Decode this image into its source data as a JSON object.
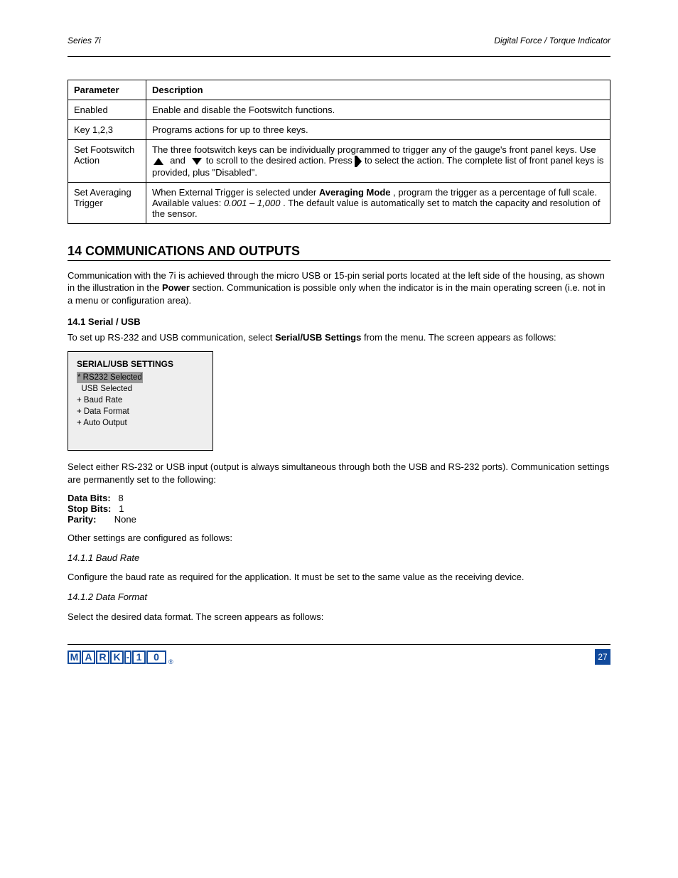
{
  "header": {
    "left": "Series 7i",
    "right": "Digital Force / Torque Indicator"
  },
  "table": {
    "headers": [
      "Parameter",
      "Description"
    ],
    "rows": [
      {
        "param": "Enabled",
        "desc": "Enable and disable the Footswitch functions."
      },
      {
        "param": "Key 1,2,3",
        "desc": "Programs actions for up to three keys."
      },
      {
        "param": "Set Footswitch Action",
        "desc_before": "The three footswitch keys can be individually programmed to trigger any of the gauge's front panel keys. Use ",
        "desc_mid": " to scroll to the desired action. Press ",
        "desc_after": " to select the action. The complete list of front panel keys is provided, plus \"Disabled\"."
      },
      {
        "param": "Set Averaging Trigger",
        "desc_before": "When External Trigger is selected under ",
        "desc_bold": "Averaging Mode",
        "desc_mid2": ", program the trigger as a percentage of full scale. Available values: ",
        "desc_italic": "0.001 – 1,000",
        "desc_after2": ". The default value is automatically set to match the capacity and resolution of the sensor."
      }
    ]
  },
  "section": {
    "number": "14",
    "title": "COMMUNICATIONS AND OUTPUTS"
  },
  "paras": {
    "p1": "Communication with the 7i is achieved through the micro USB or 15-pin serial ports located at the left side of the housing, as shown in the illustration in the ",
    "p1b": "Power",
    "p1c": " section. Communication is possible only when the indicator is in the main operating screen (i.e. not in a menu or configuration area).",
    "sub141": "14.1 Serial / USB",
    "p2a": "To set up RS-232 and USB communication, select ",
    "p2b": "Serial/USB Settings",
    "p2c": " from the menu. The screen appears as follows:"
  },
  "menu": {
    "title": "SERIAL/USB SETTINGS",
    "items": [
      "RS232 Selected",
      "USB Selected",
      "+ Baud Rate",
      "+ Data Format",
      "+ Auto Output"
    ]
  },
  "paras2": {
    "p3": "Select either RS-232 or USB input (output is always simultaneous through both the USB and RS-232 ports). Communication settings are permanently set to the following:",
    "bullets": [
      {
        "label": "Data Bits:",
        "val": "8"
      },
      {
        "label": "Stop Bits:",
        "val": "1"
      },
      {
        "label": "Parity:",
        "val": "None"
      }
    ],
    "p4": "Other settings are configured as follows:",
    "s1t": "14.1.1 Baud Rate",
    "s1p": "Configure the baud rate as required for the application. It must be set to the same value as the receiving device.",
    "s2t": "14.1.2 Data Format",
    "s2p": "Select the desired data format. The screen appears as follows:"
  },
  "logo_letters": [
    "M",
    "A",
    "R",
    "K",
    "-",
    "1",
    "0"
  ],
  "page_number": "27"
}
